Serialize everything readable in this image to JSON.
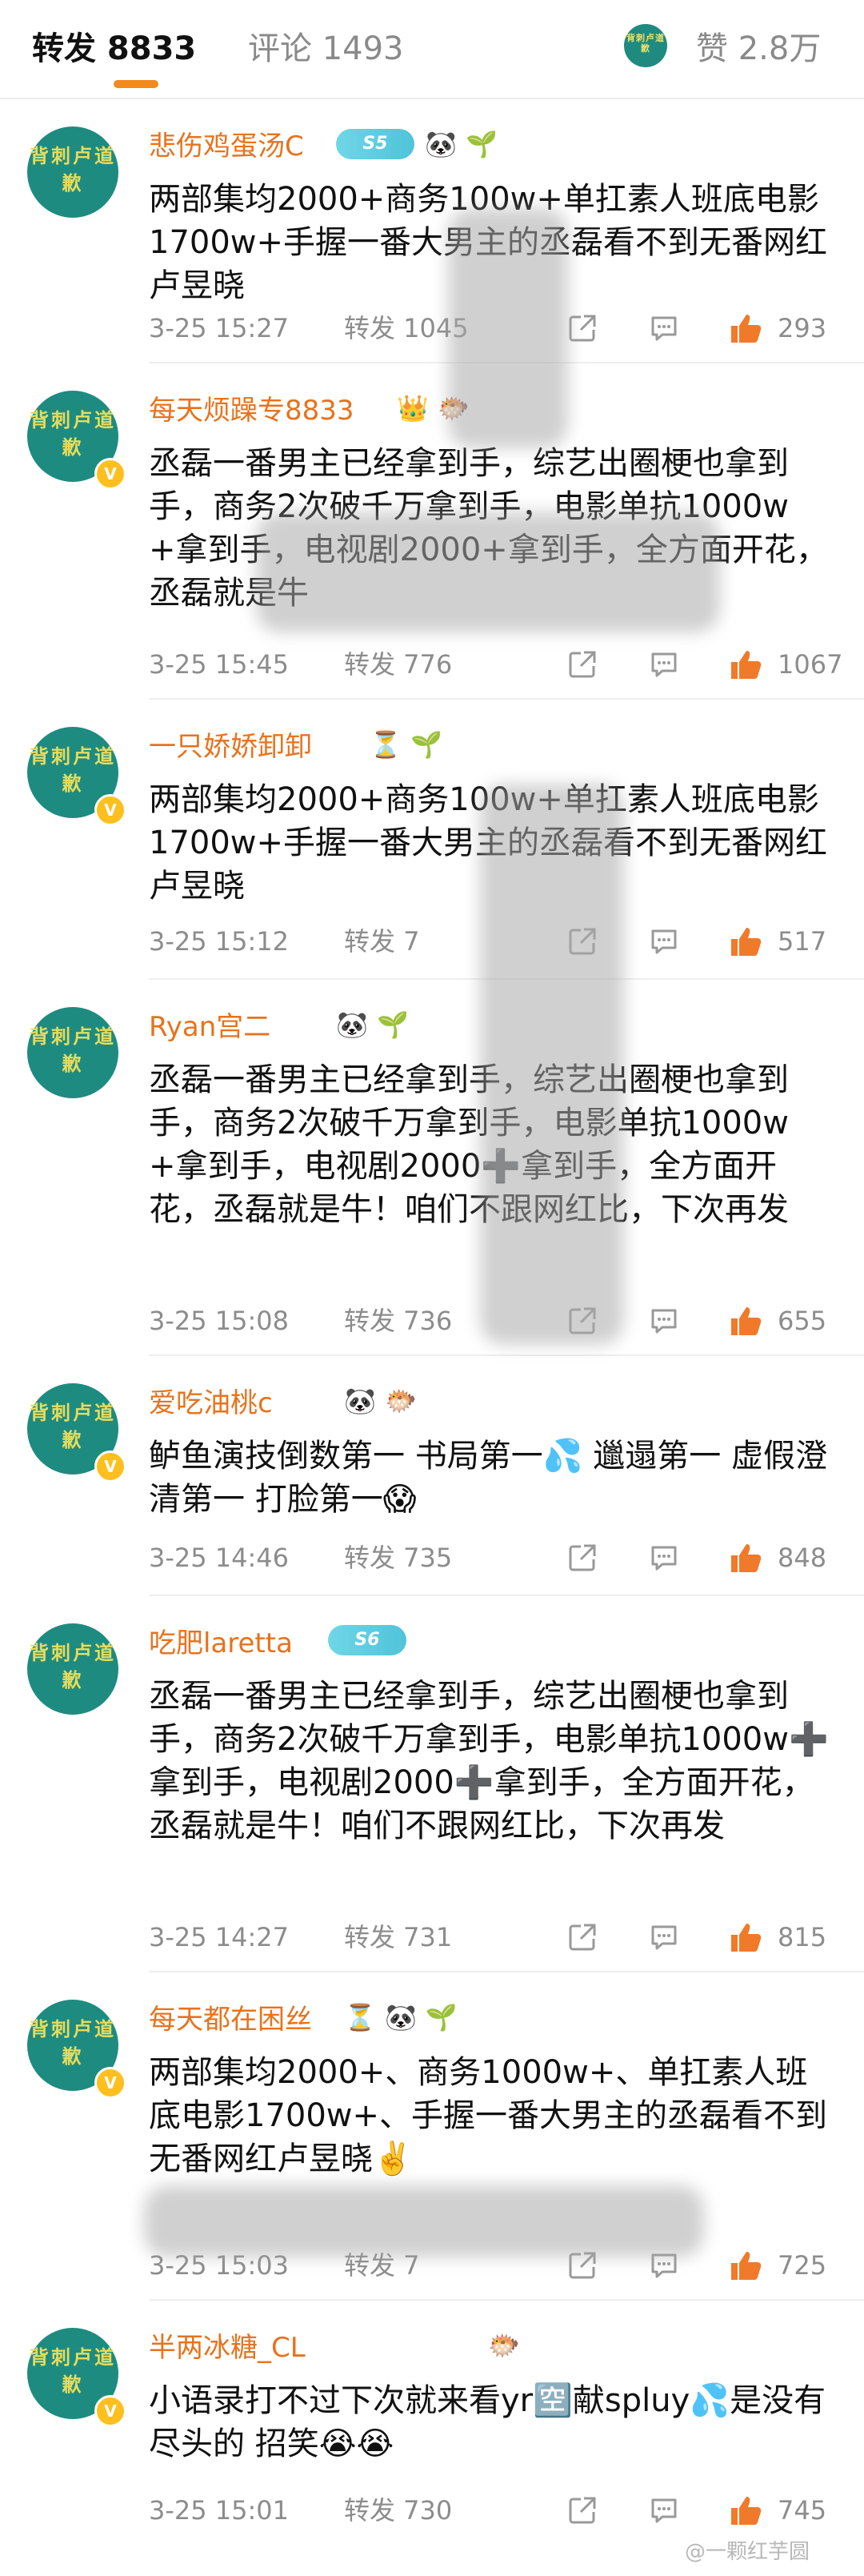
{
  "tabs": {
    "repost": "转发 8833",
    "comments": "评论 1493",
    "avatar_text": "背刺卢道歉",
    "likes": "赞 2.8万"
  },
  "avatar_text": "背刺卢道歉",
  "repost_label": "转发",
  "items": [
    {
      "username": "悲伤鸡蛋汤C",
      "level": "S5",
      "emojis": [
        "🐼",
        "🌱"
      ],
      "text": "两部集均2000+商务100w+单扛素人班底电影1700w+手握一番大男主的丞磊看不到无番网红卢昱晓",
      "time": "3-25 15:27",
      "repost": "转发 1045",
      "likes": "293",
      "verified": false
    },
    {
      "username": "每天烦躁专8833",
      "level": "",
      "emojis": [
        "👑",
        "🐡"
      ],
      "text": "丞磊一番男主已经拿到手，综艺出圈梗也拿到手，商务2次破千万拿到手，电影单抗1000w+拿到手，电视剧2000+拿到手，全方面开花，丞磊就是牛",
      "time": "3-25 15:45",
      "repost": "转发 776",
      "likes": "1067",
      "verified": true
    },
    {
      "username": "一只娇娇卸卸",
      "level": "",
      "emojis": [
        "⏳",
        "🌱"
      ],
      "text": "两部集均2000+商务100w+单扛素人班底电影1700w+手握一番大男主的丞磊看不到无番网红卢昱晓",
      "time": "3-25 15:12",
      "repost": "转发 7",
      "likes": "517",
      "verified": true
    },
    {
      "username": "Ryan宫二",
      "level": "",
      "emojis": [
        "🐼",
        "🌱"
      ],
      "text": "丞磊一番男主已经拿到手，综艺出圈梗也拿到手，商务2次破千万拿到手，电影单抗1000w+拿到手，电视剧2000➕拿到手，全方面开花，丞磊就是牛！咱们不跟网红比，下次再发",
      "time": "3-25 15:08",
      "repost": "转发 736",
      "likes": "655",
      "verified": false
    },
    {
      "username": "爱吃油桃c",
      "level": "",
      "emojis": [
        "🐼",
        "🐡"
      ],
      "text": "鲈鱼演技倒数第一 书局第一💦 邋遢第一 虚假澄清第一 打脸第一😱",
      "time": "3-25 14:46",
      "repost": "转发 735",
      "likes": "848",
      "verified": true
    },
    {
      "username": "吃肥laretta",
      "level": "S6",
      "emojis": [],
      "text": "丞磊一番男主已经拿到手，综艺出圈梗也拿到手，商务2次破千万拿到手，电影单抗1000w➕拿到手，电视剧2000➕拿到手，全方面开花，丞磊就是牛！咱们不跟网红比，下次再发",
      "time": "3-25 14:27",
      "repost": "转发 731",
      "likes": "815",
      "verified": false
    },
    {
      "username": "每天都在困丝",
      "level": "",
      "emojis": [
        "⏳",
        "🐼",
        "🌱"
      ],
      "text": "两部集均2000+、商务1000w+、单扛素人班底电影1700w+、手握一番大男主的丞磊看不到无番网红卢昱晓✌️",
      "time": "3-25 15:03",
      "repost": "转发 7",
      "likes": "725",
      "verified": true
    },
    {
      "username": "半两冰糖_CL",
      "level": "",
      "emojis": [
        "🐡"
      ],
      "text": "小语录打不过下次就来看yr🈳献spluy💦是没有尽头的 招笑😭😭",
      "time": "3-25 15:01",
      "repost": "转发 730",
      "likes": "745",
      "verified": true
    }
  ],
  "watermark": "@一颗红芋圆",
  "colors": {
    "accent": "#e8721c",
    "underline": "#f28a1c",
    "avatar_bg": "#1e8b80",
    "like": "#f07a2a"
  }
}
